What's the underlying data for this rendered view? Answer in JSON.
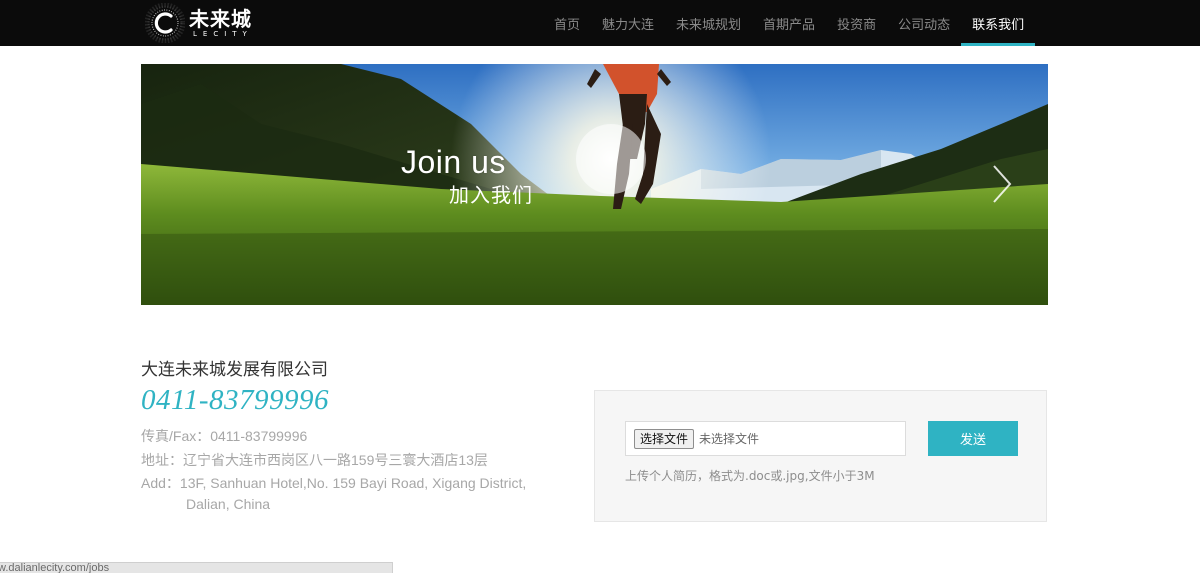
{
  "brand": {
    "name_cn": "未来城",
    "name_en": "LECITY"
  },
  "nav": {
    "items": [
      {
        "label": "首页"
      },
      {
        "label": "魅力大连"
      },
      {
        "label": "未来城规划"
      },
      {
        "label": "首期产品"
      },
      {
        "label": "投资商"
      },
      {
        "label": "公司动态"
      },
      {
        "label": "联系我们",
        "active": true
      }
    ]
  },
  "banner": {
    "title": "Join us",
    "subtitle": "加入我们",
    "next_icon": "chevron-right-icon"
  },
  "contact": {
    "company": "大连未来城发展有限公司",
    "phone": "0411-83799996",
    "fax": "传真/Fax：0411-83799996",
    "address_cn": "地址：辽宁省大连市西岗区八一路159号三寰大酒店13层",
    "address_en_line1": "Add：13F, Sanhuan Hotel,No. 159 Bayi Road, Xigang District,",
    "address_en_line2": "Dalian, China"
  },
  "upload": {
    "choose_label": "选择文件",
    "status_text": "未选择文件",
    "send_label": "发送",
    "hint": "上传个人简历，格式为.doc或.jpg,文件小于3M"
  },
  "statusbar": {
    "url": "w.dalianlecity.com/jobs"
  },
  "colors": {
    "accent": "#2fb3c3",
    "topbar": "#0b0b0b"
  }
}
